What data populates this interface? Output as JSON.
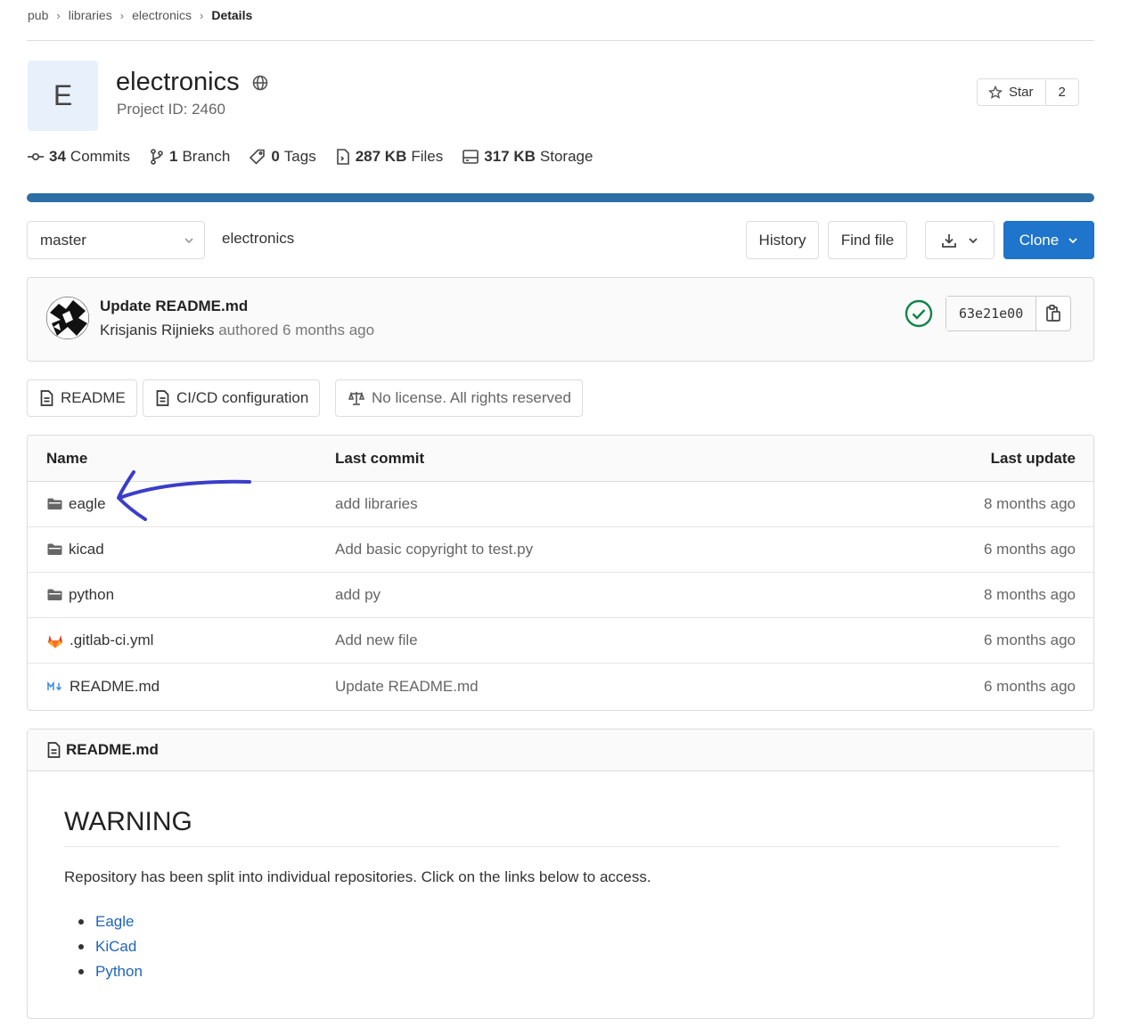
{
  "breadcrumb": [
    "pub",
    "libraries",
    "electronics",
    "Details"
  ],
  "project": {
    "avatar_letter": "E",
    "name": "electronics",
    "id_label": "Project ID: 2460",
    "star_label": "Star",
    "star_count": "2"
  },
  "stats": [
    {
      "icon": "commit-icon",
      "value": "34",
      "label": "Commits"
    },
    {
      "icon": "branch-icon",
      "value": "1",
      "label": "Branch"
    },
    {
      "icon": "tag-icon",
      "value": "0",
      "label": "Tags"
    },
    {
      "icon": "file-icon",
      "value": "287 KB",
      "label": "Files"
    },
    {
      "icon": "storage-icon",
      "value": "317 KB",
      "label": "Storage"
    }
  ],
  "toolbar": {
    "branch": "master",
    "path": "electronics",
    "history_label": "History",
    "find_file_label": "Find file",
    "clone_label": "Clone"
  },
  "last_commit": {
    "title": "Update README.md",
    "author": "Krisjanis Rijnieks",
    "meta": "authored 6 months ago",
    "sha": "63e21e00",
    "pipeline_status": "passed"
  },
  "quick_links": {
    "readme": "README",
    "cicd": "CI/CD configuration",
    "license": "No license. All rights reserved"
  },
  "table": {
    "headers": {
      "name": "Name",
      "last_commit": "Last commit",
      "last_update": "Last update"
    },
    "rows": [
      {
        "name": "eagle",
        "type": "folder",
        "commit": "add libraries",
        "updated": "8 months ago"
      },
      {
        "name": "kicad",
        "type": "folder",
        "commit": "Add basic copyright to test.py",
        "updated": "6 months ago"
      },
      {
        "name": "python",
        "type": "folder",
        "commit": "add py",
        "updated": "8 months ago"
      },
      {
        "name": ".gitlab-ci.yml",
        "type": "gitlab",
        "commit": "Add new file",
        "updated": "6 months ago"
      },
      {
        "name": "README.md",
        "type": "markdown",
        "commit": "Update README.md",
        "updated": "6 months ago"
      }
    ]
  },
  "readme": {
    "filename": "README.md",
    "heading": "WARNING",
    "paragraph": "Repository has been split into individual repositories. Click on the links below to access.",
    "links": [
      "Eagle",
      "KiCad",
      "Python"
    ]
  },
  "colors": {
    "accent": "#1f75cb",
    "progress": "#2d6ea5",
    "link": "#1f65b7",
    "success": "#108548",
    "annotation": "#3a3ec9"
  }
}
